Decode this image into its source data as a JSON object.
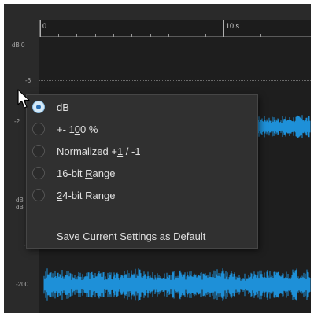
{
  "ruler": {
    "start_label": "0",
    "mid_label": "10 s",
    "unit_label": "dB 0"
  },
  "axis_labels": {
    "minus6_top": "-6",
    "minus20_partial": "-2",
    "db_stack_1": "dB",
    "db_stack_2": "dB",
    "minus6_bottom": "-6",
    "minus200": "-200"
  },
  "menu": {
    "items": [
      {
        "pre": "",
        "ul": "d",
        "post": "B",
        "checked": true
      },
      {
        "pre": "+- 1",
        "ul": "0",
        "post": "0 %",
        "checked": false
      },
      {
        "pre": "Normalized +",
        "ul": "1",
        "post": " / -1",
        "checked": false
      },
      {
        "pre": "16-bit ",
        "ul": "R",
        "post": "ange",
        "checked": false
      },
      {
        "pre": "",
        "ul": "2",
        "post": "4-bit Range",
        "checked": false
      }
    ],
    "default_action": {
      "pre": "",
      "ul": "S",
      "post": "ave Current Settings as Default"
    }
  },
  "colors": {
    "waveform": "#1e90d8",
    "background": "#2a2a2a",
    "menu_bg": "#303030"
  },
  "icons": [
    "mouse-pointer-icon",
    "radio-button-icon"
  ]
}
